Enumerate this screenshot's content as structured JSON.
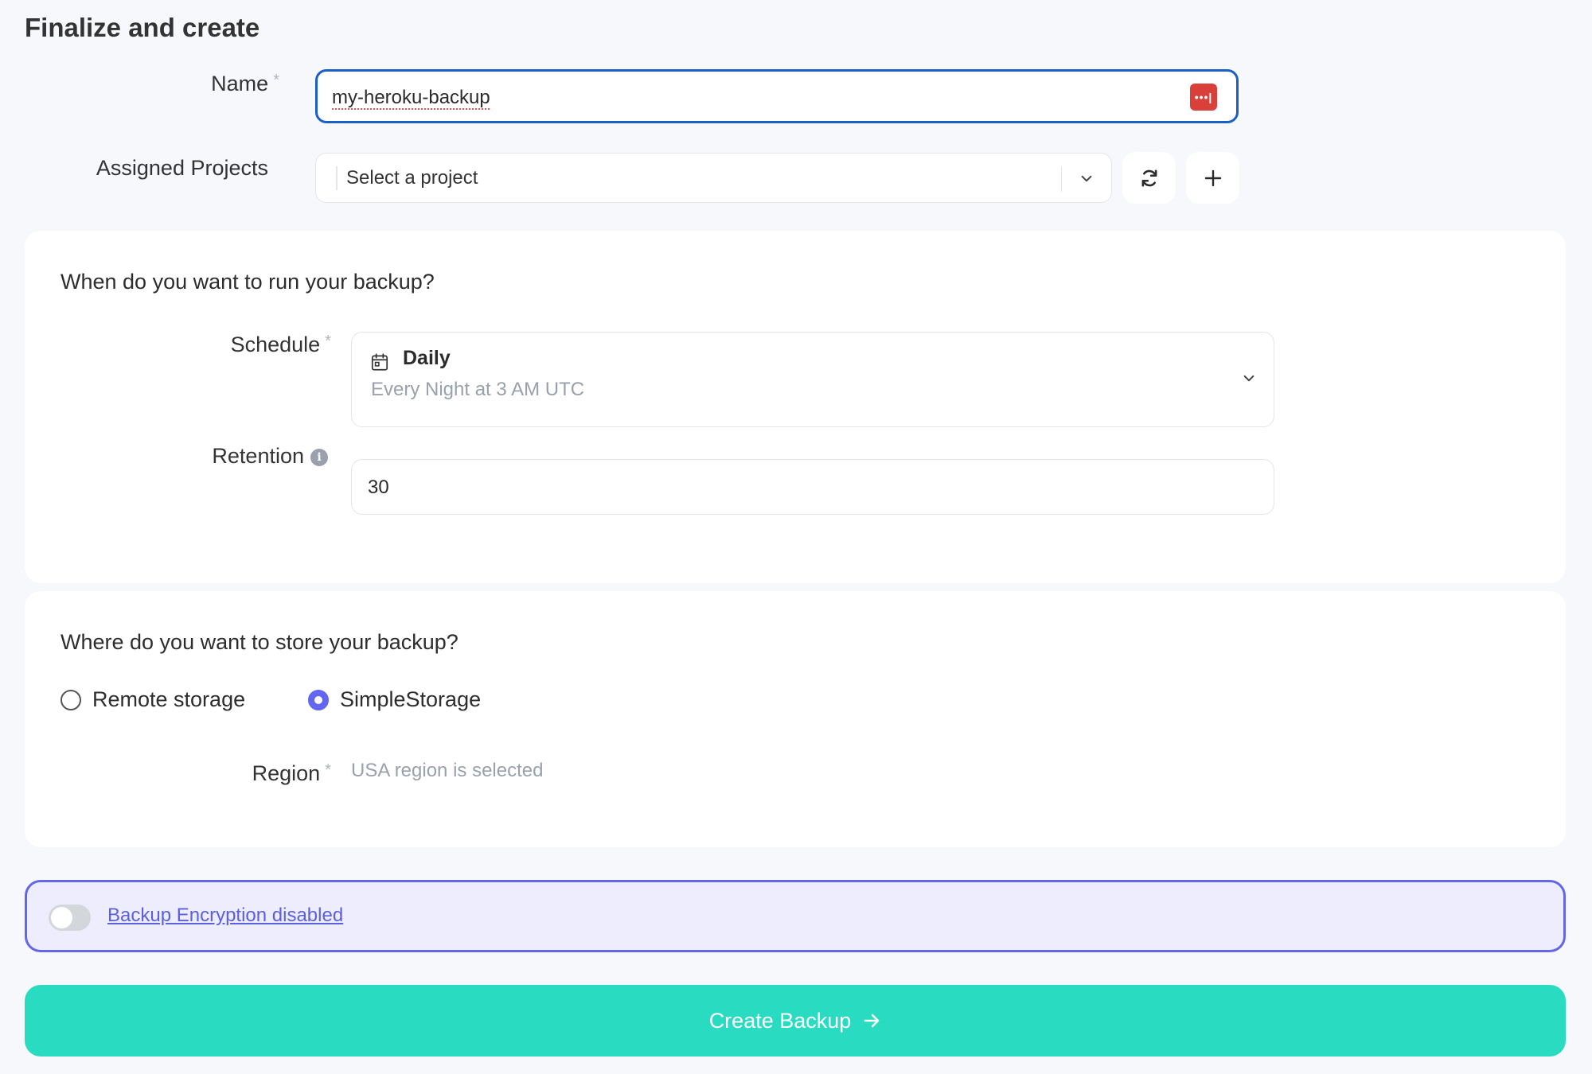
{
  "page": {
    "title": "Finalize and create"
  },
  "name_field": {
    "label": "Name",
    "required_mark": "*",
    "value": "my-heroku-backup",
    "password_manager_icon": "lastpass-icon"
  },
  "projects_field": {
    "label": "Assigned Projects",
    "placeholder": "Select a project",
    "refresh_icon": "refresh-icon",
    "add_icon": "plus-icon"
  },
  "schedule_card": {
    "title": "When do you want to run your backup?",
    "schedule": {
      "label": "Schedule",
      "required_mark": "*",
      "value": "Daily",
      "description": "Every Night at 3 AM UTC",
      "icon": "calendar-icon"
    },
    "retention": {
      "label": "Retention",
      "value": "30",
      "info_icon": "info-icon",
      "info_glyph": "i"
    }
  },
  "storage_card": {
    "title": "Where do you want to store your backup?",
    "options": [
      {
        "label": "Remote storage",
        "selected": false
      },
      {
        "label": "SimpleStorage",
        "selected": true
      }
    ],
    "region": {
      "label": "Region",
      "required_mark": "*",
      "value": "USA region is selected"
    }
  },
  "encryption": {
    "enabled": false,
    "label": "Backup Encryption disabled"
  },
  "submit": {
    "label": "Create Backup"
  },
  "colors": {
    "primary": "#6366f1",
    "submit": "#29dcc1",
    "focus_border": "#1a5fc7",
    "background": "#f7f8fc"
  }
}
